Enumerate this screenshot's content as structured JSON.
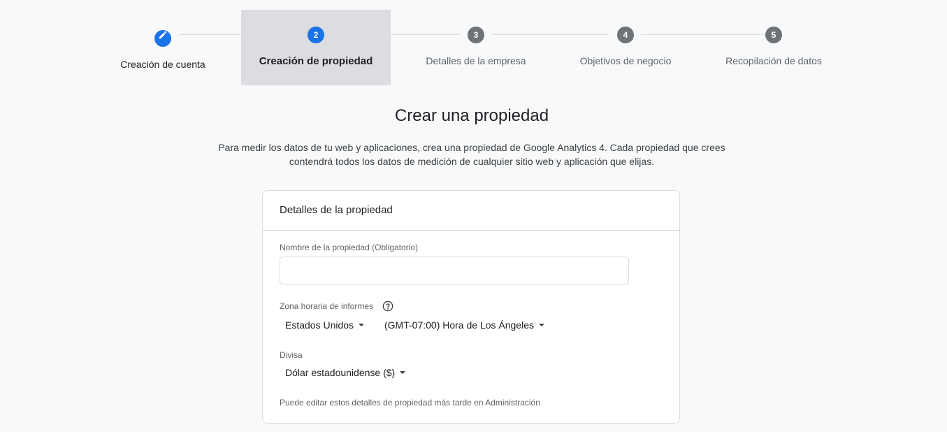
{
  "stepper": {
    "steps": [
      {
        "number": "1",
        "label": "Creación de cuenta",
        "state": "done",
        "icon": "pencil-icon"
      },
      {
        "number": "2",
        "label": "Creación de propiedad",
        "state": "active"
      },
      {
        "number": "3",
        "label": "Detalles de la empresa",
        "state": "pending"
      },
      {
        "number": "4",
        "label": "Objetivos de negocio",
        "state": "pending"
      },
      {
        "number": "5",
        "label": "Recopilación de datos",
        "state": "pending"
      }
    ]
  },
  "page": {
    "title": "Crear una propiedad",
    "description_line1": "Para medir los datos de tu web y aplicaciones, crea una propiedad de Google Analytics 4. Cada propiedad que crees",
    "description_line2": "contendrá todos los datos de medición de cualquier sitio web y aplicación que elijas."
  },
  "card": {
    "title": "Detalles de la propiedad",
    "property_name": {
      "label": "Nombre de la propiedad (Obligatorio)",
      "value": "",
      "placeholder": ""
    },
    "timezone": {
      "label": "Zona horaria de informes",
      "help_icon": "help-circle-icon",
      "country": "Estados Unidos",
      "zone": "(GMT-07:00) Hora de Los Ángeles"
    },
    "currency": {
      "label": "Divisa",
      "value": "Dólar estadounidense ($)"
    },
    "hint": "Puede editar estos detalles de propiedad más tarde en Administración"
  },
  "colors": {
    "accent": "#1a73e8",
    "pending_step": "#6f7276",
    "background": "#f8f9fa",
    "active_step_highlight": "#dcdde0"
  }
}
